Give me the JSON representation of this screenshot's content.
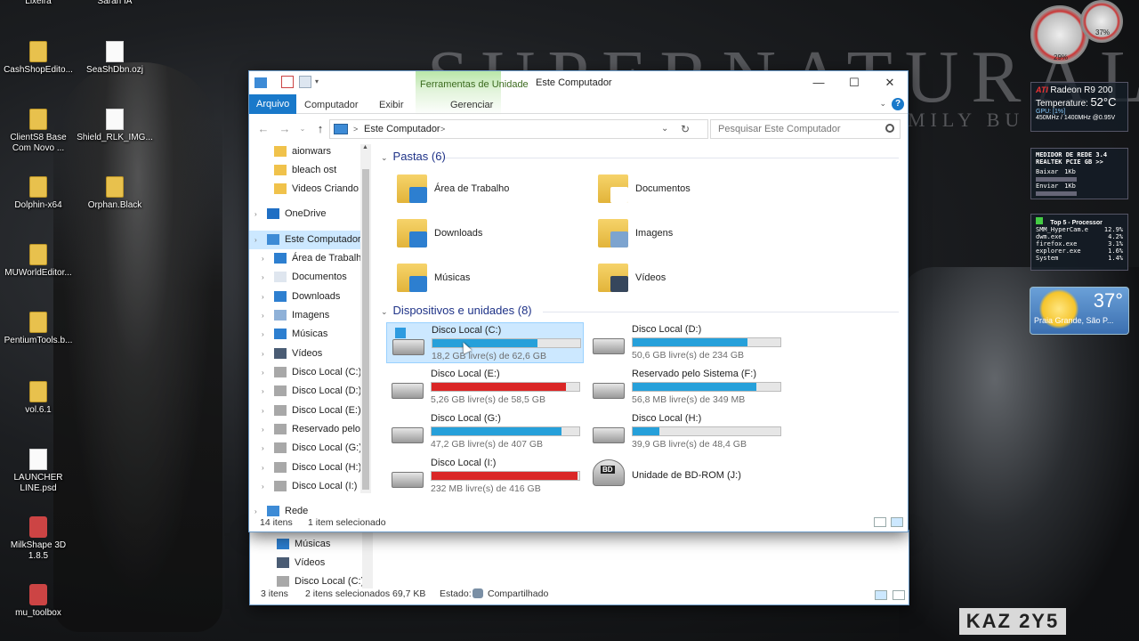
{
  "wallpaper": {
    "title": "SUPERNATURAL",
    "subtitle": "MILY BU",
    "plate": "KAZ 2Y5"
  },
  "desktop_icons": [
    {
      "label": "Lixeira",
      "glyph": "folder"
    },
    {
      "label": "Sarah IA",
      "glyph": "file"
    },
    {
      "label": "CashShopEdito...",
      "glyph": "folder"
    },
    {
      "label": "SeaShDbn.ozj",
      "glyph": "file"
    },
    {
      "label": "ClientS8 Base Com Novo ...",
      "glyph": "folder"
    },
    {
      "label": "Shield_RLK_IMG...",
      "glyph": "file"
    },
    {
      "label": "Dolphin-x64",
      "glyph": "folder"
    },
    {
      "label": "Orphan.Black",
      "glyph": "folder"
    },
    {
      "label": "MUWorldEditor...",
      "glyph": "folder"
    },
    {
      "label": "PentiumTools.b...",
      "glyph": "folder"
    },
    {
      "label": "vol.6.1",
      "glyph": "folder"
    },
    {
      "label": "LAUNCHER LINE.psd",
      "glyph": "file"
    },
    {
      "label": "MilkShape 3D 1.8.5",
      "glyph": "app"
    },
    {
      "label": "mu_toolbox",
      "glyph": "app"
    }
  ],
  "gadgets": {
    "gauge1": "29%",
    "gauge2": "37%",
    "gpu_name": "Radeon R9 200",
    "gpu_temp_label": "Temperature:",
    "gpu_temp": "52°C",
    "gpu_load": "GPU: [1%]",
    "gpu_clock": "450MHz / 1400MHz @0.95V",
    "net_title": "MEDIDOR DE REDE 3.4",
    "net_adapter": "REALTEK PCIE GB >>",
    "net_down_label": "Baixar",
    "net_down": "1Kb",
    "net_up_label": "Enviar",
    "net_up": "1Kb",
    "proc_title": "Top 5 - Processor",
    "processes": [
      {
        "name": "SMM_HyperCam.e",
        "pct": "12.9%"
      },
      {
        "name": "dwm.exe",
        "pct": "4.2%"
      },
      {
        "name": "firefox.exe",
        "pct": "3.1%"
      },
      {
        "name": "explorer.exe",
        "pct": "1.6%"
      },
      {
        "name": "System",
        "pct": "1.4%"
      }
    ],
    "weather_temp": "37°",
    "weather_city": "Praia Grande, São P..."
  },
  "back_window": {
    "nav": [
      {
        "label": "Músicas",
        "icon": "music-icon"
      },
      {
        "label": "Vídeos",
        "icon": "video-icon"
      },
      {
        "label": "Disco Local (C:)",
        "icon": "drive-icon"
      }
    ],
    "status": {
      "count": "3 itens",
      "selected": "2 itens selecionados",
      "size": "69,7 KB",
      "state_label": "Estado:",
      "state": "Compartilhado"
    }
  },
  "window": {
    "title": "Este Computador",
    "context_group": "Ferramentas de Unidade",
    "controls": {
      "min": "—",
      "max": "☐",
      "close": "✕"
    },
    "ribbon_tabs": [
      "Arquivo",
      "Computador",
      "Exibir"
    ],
    "context_tab": "Gerenciar",
    "help": "?",
    "address": {
      "crumb": "Este Computador",
      "sep": ">"
    },
    "search_placeholder": "Pesquisar Este Computador",
    "nav_items": [
      {
        "label": "aionwars",
        "icon": "folder-icon"
      },
      {
        "label": "bleach ost",
        "icon": "folder-icon"
      },
      {
        "label": "Videos Criando S",
        "icon": "folder-icon"
      },
      {
        "label": "OneDrive",
        "icon": "onedrive-icon"
      },
      {
        "label": "Este Computador",
        "icon": "computer-icon"
      },
      {
        "label": "Área de Trabalho",
        "icon": "desktop-icon"
      },
      {
        "label": "Documentos",
        "icon": "documents-icon"
      },
      {
        "label": "Downloads",
        "icon": "downloads-icon"
      },
      {
        "label": "Imagens",
        "icon": "pictures-icon"
      },
      {
        "label": "Músicas",
        "icon": "music-icon"
      },
      {
        "label": "Vídeos",
        "icon": "video-icon"
      },
      {
        "label": "Disco Local (C:)",
        "icon": "drive-icon"
      },
      {
        "label": "Disco Local (D:)",
        "icon": "drive-icon"
      },
      {
        "label": "Disco Local (E:)",
        "icon": "drive-icon"
      },
      {
        "label": "Reservado pelo S",
        "icon": "drive-icon"
      },
      {
        "label": "Disco Local (G:)",
        "icon": "drive-icon"
      },
      {
        "label": "Disco Local (H:)",
        "icon": "drive-icon"
      },
      {
        "label": "Disco Local (I:)",
        "icon": "drive-icon"
      },
      {
        "label": "Rede",
        "icon": "network-icon"
      }
    ],
    "folders_header": "Pastas (6)",
    "folders": [
      "Área de Trabalho",
      "Documentos",
      "Downloads",
      "Imagens",
      "Músicas",
      "Vídeos"
    ],
    "drives_header": "Dispositivos e unidades (8)",
    "drives": [
      {
        "name": "Disco Local (C:)",
        "free": "18,2 GB livre(s) de 62,6 GB",
        "used_fraction": 0.71,
        "color": "#26a0da",
        "selected": true
      },
      {
        "name": "Disco Local (D:)",
        "free": "50,6 GB livre(s) de 234 GB",
        "used_fraction": 0.78,
        "color": "#26a0da"
      },
      {
        "name": "Disco Local (E:)",
        "free": "5,26 GB livre(s) de 58,5 GB",
        "used_fraction": 0.91,
        "color": "#da2626"
      },
      {
        "name": "Reservado pelo Sistema (F:)",
        "free": "56,8 MB livre(s) de 349 MB",
        "used_fraction": 0.84,
        "color": "#26a0da"
      },
      {
        "name": "Disco Local (G:)",
        "free": "47,2 GB livre(s) de 407 GB",
        "used_fraction": 0.88,
        "color": "#26a0da"
      },
      {
        "name": "Disco Local (H:)",
        "free": "39,9 GB livre(s) de 48,4 GB",
        "used_fraction": 0.18,
        "color": "#26a0da"
      },
      {
        "name": "Disco Local (I:)",
        "free": "232 MB livre(s) de 416 GB",
        "used_fraction": 0.99,
        "color": "#da2626"
      },
      {
        "name": "Unidade de BD-ROM (J:)",
        "free": "",
        "optical": true,
        "badge": "BD"
      }
    ],
    "status": {
      "count": "14 itens",
      "selected": "1 item selecionado"
    }
  }
}
